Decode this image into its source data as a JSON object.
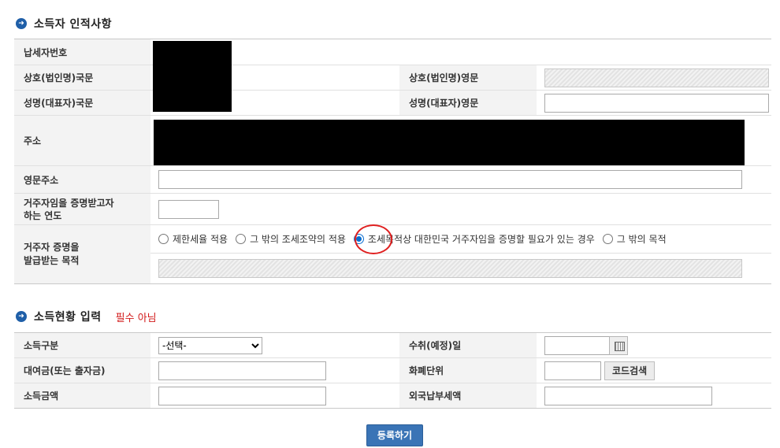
{
  "section1": {
    "title": "소득자 인적사항",
    "tin_label": "납세자번호",
    "company_kr_label": "상호(법인명)국문",
    "company_en_label": "상호(법인명)영문",
    "rep_kr_label": "성명(대표자)국문",
    "rep_en_label": "성명(대표자)영문",
    "address_label": "주소",
    "address_en_label": "영문주소",
    "year_label_1": "거주자임을 증명받고자",
    "year_label_2": "하는 연도",
    "purpose_label_1": "거주자 증명을",
    "purpose_label_2": "발급받는 목적",
    "purpose_options": [
      "제한세율 적용",
      "그 밖의 조세조약의 적용",
      "조세목적상 대한민국 거주자임을 증명할 필요가 있는 경우",
      "그 밖의 목적"
    ],
    "purpose_selected_index": 2
  },
  "section2": {
    "title": "소득현황 입력",
    "note": "필수 아님",
    "income_type_label": "소득구분",
    "income_type_value": "-선택-",
    "receipt_date_label": "수취(예정)일",
    "loan_label": "대여금(또는 출자금)",
    "currency_label": "화폐단위",
    "code_search_label": "코드검색",
    "income_amount_label": "소득금액",
    "foreign_tax_label": "외국납부세액"
  },
  "submit_label": "등록하기",
  "colors": {
    "accent": "#1f5fa8",
    "note_red": "#d21a1a",
    "submit_bg": "#3a74b6"
  }
}
